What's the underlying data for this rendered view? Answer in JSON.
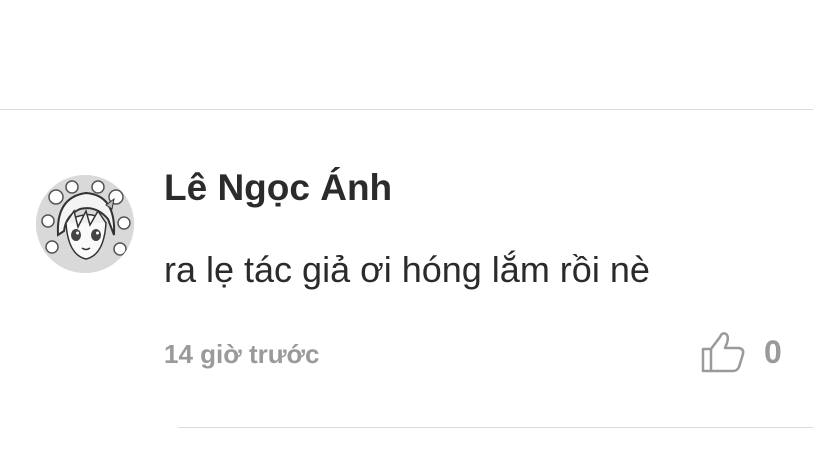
{
  "comment": {
    "author": "Lê Ngọc Ánh",
    "text": "ra lẹ tác giả ơi hóng lắm rồi nè",
    "timestamp": "14 giờ trước",
    "like_count": "0",
    "avatar_icon": "avatar-illustration-icon",
    "like_icon": "thumbs-up-outline-icon"
  },
  "colors": {
    "text": "#2b2b2b",
    "muted": "#9a9a9a",
    "divider": "#dcdcdc"
  }
}
